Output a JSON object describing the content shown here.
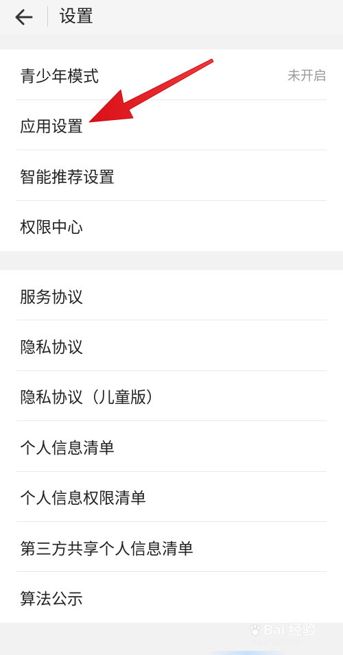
{
  "header": {
    "title": "设置",
    "back_icon": "back-arrow-icon"
  },
  "groups": [
    {
      "items": [
        {
          "label": "青少年模式",
          "value": "未开启"
        },
        {
          "label": "应用设置"
        },
        {
          "label": "智能推荐设置"
        },
        {
          "label": "权限中心"
        }
      ]
    },
    {
      "items": [
        {
          "label": "服务协议"
        },
        {
          "label": "隐私协议"
        },
        {
          "label": "隐私协议（儿童版）"
        },
        {
          "label": "个人信息清单"
        },
        {
          "label": "个人信息权限清单"
        },
        {
          "label": "第三方共享个人信息清单"
        },
        {
          "label": "算法公示"
        }
      ]
    }
  ],
  "annotation": {
    "color": "#e8141b",
    "points_to": "应用设置"
  },
  "watermark": {
    "main": "Bai 经验",
    "sub": "jingyan.baidu.com"
  }
}
